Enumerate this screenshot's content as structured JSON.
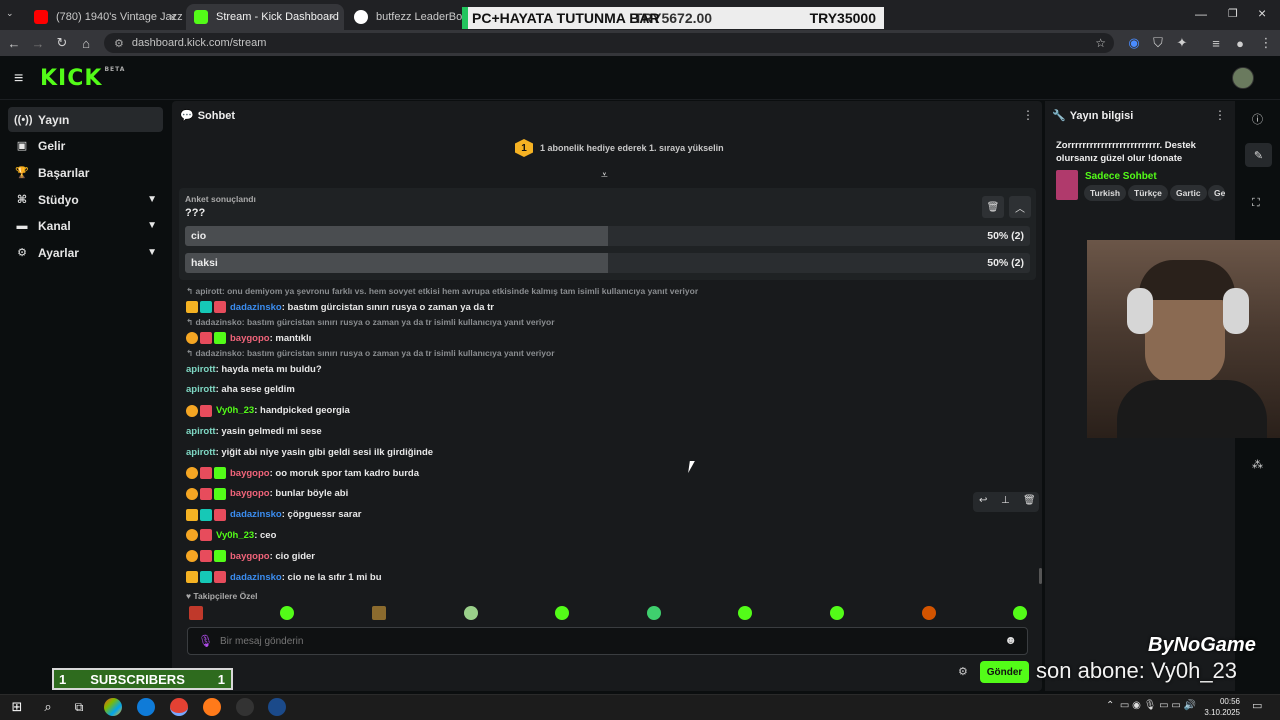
{
  "browser": {
    "tabs": [
      {
        "title": "(780) 1940's Vintage Jazz Pl",
        "color": "#ff0000"
      },
      {
        "title": "Stream - Kick Dashboard",
        "color": "#53fc18"
      },
      {
        "title": "butfezz LeaderBoard | The L",
        "color": "#ffffff"
      }
    ],
    "url": "dashboard.kick.com/stream"
  },
  "overlay_top": {
    "left_text": "PC+HAYATA TUTUNMA BAR",
    "mid_text": "TRY5672.00",
    "right_text": "TRY35000"
  },
  "kick": {
    "logo": "KICK",
    "beta": "BETA"
  },
  "sidebar": {
    "items": [
      {
        "label": "Yayın",
        "icon": "broadcast-icon",
        "active": true
      },
      {
        "label": "Gelir",
        "icon": "revenue-icon"
      },
      {
        "label": "Başarılar",
        "icon": "trophy-icon"
      },
      {
        "label": "Stüdyo",
        "icon": "studio-icon",
        "expandable": true
      },
      {
        "label": "Kanal",
        "icon": "channel-icon",
        "expandable": true
      },
      {
        "label": "Ayarlar",
        "icon": "gear-icon",
        "expandable": true
      }
    ]
  },
  "chat": {
    "title": "Sohbet",
    "gift_banner": "1 abonelik hediye ederek 1. sıraya yükselin",
    "gift_rank": "1",
    "poll": {
      "status": "Anket sonuçlandı",
      "question": "???",
      "options": [
        {
          "label": "cio",
          "percent": 50,
          "percent_text": "50% (2)"
        },
        {
          "label": "haksi",
          "percent": 50,
          "percent_text": "50% (2)"
        }
      ]
    },
    "messages": [
      {
        "reply": "apirott: onu demiyom ya şevronu farklı vs. hem sovyet etkisi hem avrupa etkisinde kalmış tam isimli kullanıcıya yanıt veriyor"
      },
      {
        "badges": [
          "crown",
          "og",
          "gift"
        ],
        "user": "dadazinsko",
        "color": "#3b8df0",
        "text": ": bastım gürcistan sınırı rusya o zaman ya da tr"
      },
      {
        "reply": "dadazinsko: bastım gürcistan sınırı rusya o zaman ya da tr isimli kullanıcıya yanıt veriyor"
      },
      {
        "badges": [
          "coin",
          "gift",
          "sub"
        ],
        "user": "baygopo",
        "color": "#f0647a",
        "text": ": mantıklı"
      },
      {
        "reply": "dadazinsko: bastım gürcistan sınırı rusya o zaman ya da tr isimli kullanıcıya yanıt veriyor"
      },
      {
        "badges": [],
        "user": "apirott",
        "color": "#7fd8c4",
        "text": ": hayda meta mı buldu?"
      },
      {
        "badges": [],
        "user": "apirott",
        "color": "#7fd8c4",
        "text": ": aha sese geldim"
      },
      {
        "badges": [
          "coin",
          "gift"
        ],
        "user": "Vy0h_23",
        "color": "#53fc18",
        "text": ": handpicked georgia"
      },
      {
        "badges": [],
        "user": "apirott",
        "color": "#7fd8c4",
        "text": ": yasin gelmedi mi sese"
      },
      {
        "badges": [],
        "user": "apirott",
        "color": "#7fd8c4",
        "text": ": yiğit abi niye yasin gibi geldi sesi ilk girdiğinde"
      },
      {
        "badges": [
          "coin",
          "gift",
          "sub"
        ],
        "user": "baygopo",
        "color": "#f0647a",
        "text": ": oo moruk spor tam kadro burda"
      },
      {
        "badges": [
          "coin",
          "gift",
          "sub"
        ],
        "user": "baygopo",
        "color": "#f0647a",
        "text": ": bunlar böyle abi"
      },
      {
        "badges": [
          "crown",
          "og",
          "gift"
        ],
        "user": "dadazinsko",
        "color": "#3b8df0",
        "text": ": çöpguessr sarar"
      },
      {
        "badges": [
          "coin",
          "gift"
        ],
        "user": "Vy0h_23",
        "color": "#53fc18",
        "text": ": ceo"
      },
      {
        "badges": [
          "coin",
          "gift",
          "sub"
        ],
        "user": "baygopo",
        "color": "#f0647a",
        "text": ": cio gider"
      },
      {
        "badges": [
          "crown",
          "og",
          "gift"
        ],
        "user": "dadazinsko",
        "color": "#3b8df0",
        "text": ": cio ne la sıfır 1 mi bu"
      }
    ],
    "followers_only": "Takipçilere Özel",
    "input_placeholder": "Bir mesaj gönderin",
    "send_label": "Gönder"
  },
  "info": {
    "title": "Yayın bilgisi",
    "stream_title": "Zorrrrrrrrrrrrrrrrrrrrrrrrr. Destek olursanız güzel olur !donate",
    "category": "Sadece Sohbet",
    "tags": [
      "Turkish",
      "Türkçe",
      "Gartic",
      "Ge"
    ]
  },
  "overlay_bottom": {
    "subs_count_left": "1",
    "subs_label": "SUBSCRIBERS",
    "subs_count_right": "1",
    "bynogame": "ByNoGame",
    "last_sub": "son abone: Vy0h_23"
  },
  "taskbar": {
    "time": "00:56",
    "date": "3.10.2025"
  }
}
